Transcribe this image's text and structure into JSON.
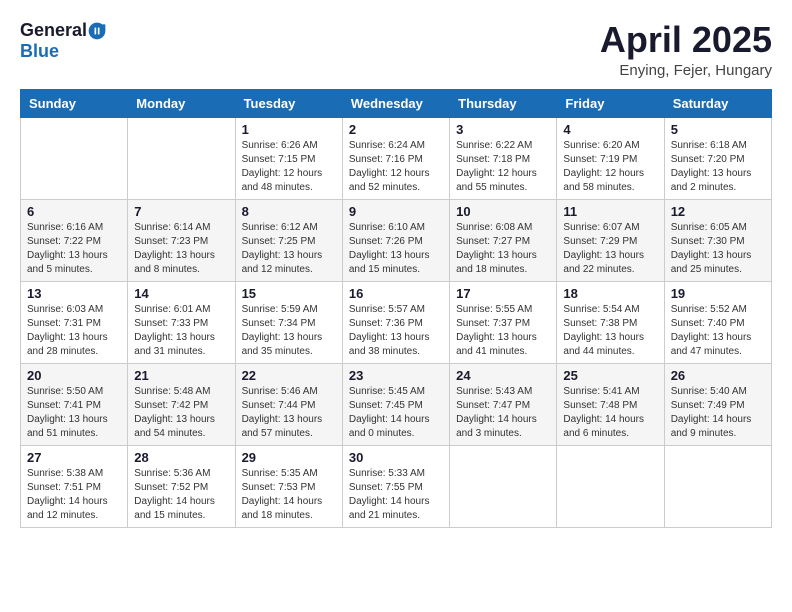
{
  "logo": {
    "general": "General",
    "blue": "Blue"
  },
  "header": {
    "month": "April 2025",
    "location": "Enying, Fejer, Hungary"
  },
  "weekdays": [
    "Sunday",
    "Monday",
    "Tuesday",
    "Wednesday",
    "Thursday",
    "Friday",
    "Saturday"
  ],
  "weeks": [
    [
      {
        "day": "",
        "info": ""
      },
      {
        "day": "",
        "info": ""
      },
      {
        "day": "1",
        "info": "Sunrise: 6:26 AM\nSunset: 7:15 PM\nDaylight: 12 hours\nand 48 minutes."
      },
      {
        "day": "2",
        "info": "Sunrise: 6:24 AM\nSunset: 7:16 PM\nDaylight: 12 hours\nand 52 minutes."
      },
      {
        "day": "3",
        "info": "Sunrise: 6:22 AM\nSunset: 7:18 PM\nDaylight: 12 hours\nand 55 minutes."
      },
      {
        "day": "4",
        "info": "Sunrise: 6:20 AM\nSunset: 7:19 PM\nDaylight: 12 hours\nand 58 minutes."
      },
      {
        "day": "5",
        "info": "Sunrise: 6:18 AM\nSunset: 7:20 PM\nDaylight: 13 hours\nand 2 minutes."
      }
    ],
    [
      {
        "day": "6",
        "info": "Sunrise: 6:16 AM\nSunset: 7:22 PM\nDaylight: 13 hours\nand 5 minutes."
      },
      {
        "day": "7",
        "info": "Sunrise: 6:14 AM\nSunset: 7:23 PM\nDaylight: 13 hours\nand 8 minutes."
      },
      {
        "day": "8",
        "info": "Sunrise: 6:12 AM\nSunset: 7:25 PM\nDaylight: 13 hours\nand 12 minutes."
      },
      {
        "day": "9",
        "info": "Sunrise: 6:10 AM\nSunset: 7:26 PM\nDaylight: 13 hours\nand 15 minutes."
      },
      {
        "day": "10",
        "info": "Sunrise: 6:08 AM\nSunset: 7:27 PM\nDaylight: 13 hours\nand 18 minutes."
      },
      {
        "day": "11",
        "info": "Sunrise: 6:07 AM\nSunset: 7:29 PM\nDaylight: 13 hours\nand 22 minutes."
      },
      {
        "day": "12",
        "info": "Sunrise: 6:05 AM\nSunset: 7:30 PM\nDaylight: 13 hours\nand 25 minutes."
      }
    ],
    [
      {
        "day": "13",
        "info": "Sunrise: 6:03 AM\nSunset: 7:31 PM\nDaylight: 13 hours\nand 28 minutes."
      },
      {
        "day": "14",
        "info": "Sunrise: 6:01 AM\nSunset: 7:33 PM\nDaylight: 13 hours\nand 31 minutes."
      },
      {
        "day": "15",
        "info": "Sunrise: 5:59 AM\nSunset: 7:34 PM\nDaylight: 13 hours\nand 35 minutes."
      },
      {
        "day": "16",
        "info": "Sunrise: 5:57 AM\nSunset: 7:36 PM\nDaylight: 13 hours\nand 38 minutes."
      },
      {
        "day": "17",
        "info": "Sunrise: 5:55 AM\nSunset: 7:37 PM\nDaylight: 13 hours\nand 41 minutes."
      },
      {
        "day": "18",
        "info": "Sunrise: 5:54 AM\nSunset: 7:38 PM\nDaylight: 13 hours\nand 44 minutes."
      },
      {
        "day": "19",
        "info": "Sunrise: 5:52 AM\nSunset: 7:40 PM\nDaylight: 13 hours\nand 47 minutes."
      }
    ],
    [
      {
        "day": "20",
        "info": "Sunrise: 5:50 AM\nSunset: 7:41 PM\nDaylight: 13 hours\nand 51 minutes."
      },
      {
        "day": "21",
        "info": "Sunrise: 5:48 AM\nSunset: 7:42 PM\nDaylight: 13 hours\nand 54 minutes."
      },
      {
        "day": "22",
        "info": "Sunrise: 5:46 AM\nSunset: 7:44 PM\nDaylight: 13 hours\nand 57 minutes."
      },
      {
        "day": "23",
        "info": "Sunrise: 5:45 AM\nSunset: 7:45 PM\nDaylight: 14 hours\nand 0 minutes."
      },
      {
        "day": "24",
        "info": "Sunrise: 5:43 AM\nSunset: 7:47 PM\nDaylight: 14 hours\nand 3 minutes."
      },
      {
        "day": "25",
        "info": "Sunrise: 5:41 AM\nSunset: 7:48 PM\nDaylight: 14 hours\nand 6 minutes."
      },
      {
        "day": "26",
        "info": "Sunrise: 5:40 AM\nSunset: 7:49 PM\nDaylight: 14 hours\nand 9 minutes."
      }
    ],
    [
      {
        "day": "27",
        "info": "Sunrise: 5:38 AM\nSunset: 7:51 PM\nDaylight: 14 hours\nand 12 minutes."
      },
      {
        "day": "28",
        "info": "Sunrise: 5:36 AM\nSunset: 7:52 PM\nDaylight: 14 hours\nand 15 minutes."
      },
      {
        "day": "29",
        "info": "Sunrise: 5:35 AM\nSunset: 7:53 PM\nDaylight: 14 hours\nand 18 minutes."
      },
      {
        "day": "30",
        "info": "Sunrise: 5:33 AM\nSunset: 7:55 PM\nDaylight: 14 hours\nand 21 minutes."
      },
      {
        "day": "",
        "info": ""
      },
      {
        "day": "",
        "info": ""
      },
      {
        "day": "",
        "info": ""
      }
    ]
  ]
}
